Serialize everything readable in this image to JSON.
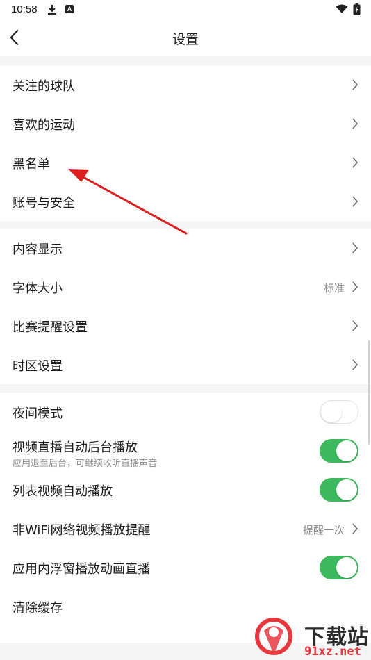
{
  "status_bar": {
    "time": "10:58"
  },
  "header": {
    "title": "设置"
  },
  "sections": [
    {
      "items": [
        {
          "label": "关注的球队"
        },
        {
          "label": "喜欢的运动"
        },
        {
          "label": "黑名单"
        },
        {
          "label": "账号与安全"
        }
      ]
    },
    {
      "items": [
        {
          "label": "内容显示"
        },
        {
          "label": "字体大小",
          "value": "标准"
        },
        {
          "label": "比赛提醒设置"
        },
        {
          "label": "时区设置"
        }
      ]
    },
    {
      "items": [
        {
          "label": "夜间模式",
          "toggle": false
        },
        {
          "label": "视频直播自动后台播放",
          "subtitle": "应用退至后台，可继续收听直播声音",
          "toggle": true
        },
        {
          "label": "列表视频自动播放",
          "toggle": true
        },
        {
          "label": "非WiFi网络视频播放提醒",
          "value": "提醒一次"
        },
        {
          "label": "应用内浮窗播放动画直播",
          "toggle": true
        },
        {
          "label": "清除缓存"
        }
      ]
    }
  ],
  "watermark": {
    "text": "下载站",
    "domain": "91xz.net"
  },
  "colors": {
    "toggle_on": "#3cb95c",
    "annotation_arrow": "#d9201f",
    "watermark_red": "#e8383d"
  }
}
